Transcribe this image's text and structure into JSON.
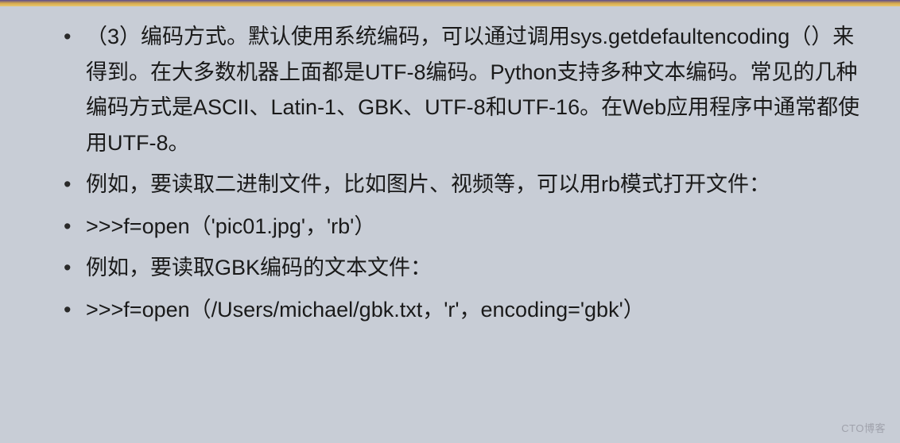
{
  "bullets": [
    "（3）编码方式。默认使用系统编码，可以通过调用sys.getdefaultencoding（）来得到。在大多数机器上面都是UTF-8编码。Python支持多种文本编码。常见的几种编码方式是ASCII、Latin-1、GBK、UTF-8和UTF-16。在Web应用程序中通常都使用UTF-8。",
    "例如，要读取二进制文件，比如图片、视频等，可以用rb模式打开文件：",
    ">>>f=open（'pic01.jpg'，'rb'）",
    "例如，要读取GBK编码的文本文件：",
    ">>>f=open（/Users/michael/gbk.txt，'r'，encoding='gbk'）"
  ],
  "watermark": "CTO博客"
}
